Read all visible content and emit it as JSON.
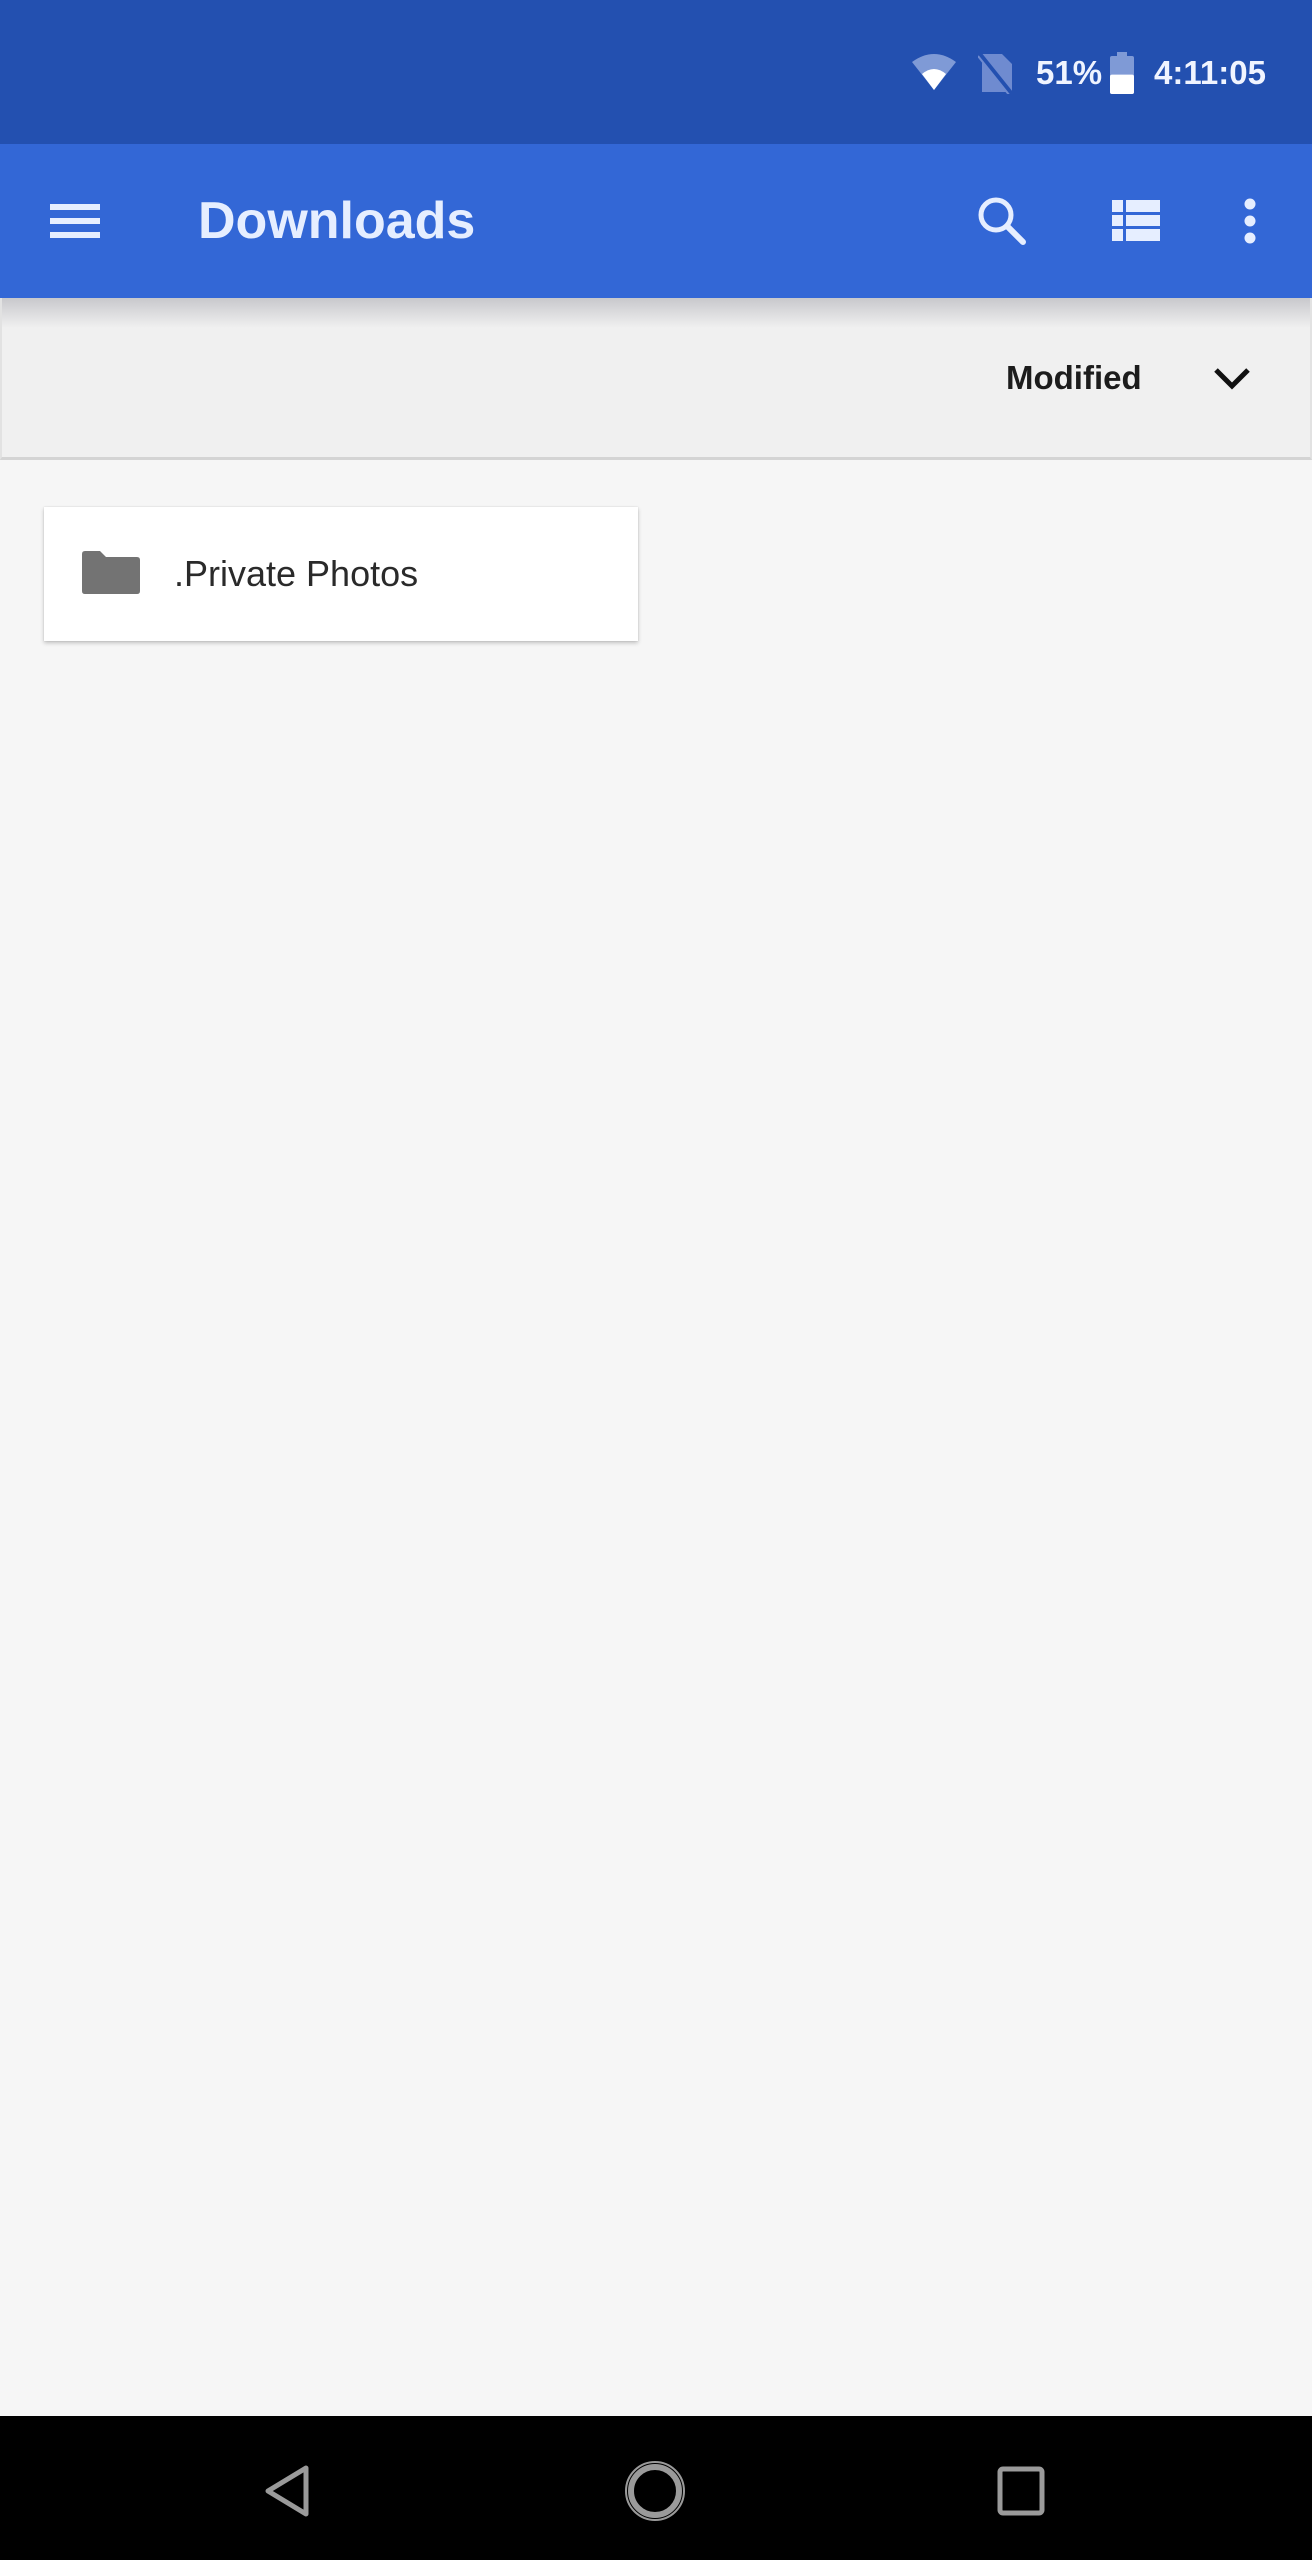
{
  "status_bar": {
    "icons": [
      "wifi-icon",
      "no-sim-icon",
      "battery-icon"
    ],
    "battery_percent": "51%",
    "battery_level": 0.51,
    "time": "4:11:05"
  },
  "app_bar": {
    "title": "Downloads",
    "nav_icon": "menu-icon",
    "actions": [
      {
        "name": "search",
        "icon": "search-icon"
      },
      {
        "name": "view-mode",
        "icon": "list-view-icon"
      },
      {
        "name": "more-options",
        "icon": "more-vert-icon"
      }
    ],
    "colors": {
      "status_bar": "#2350b0",
      "app_bar": "#3367d6",
      "text": "#e6eeff"
    }
  },
  "sort_bar": {
    "selected": "Modified",
    "icon": "chevron-down-icon"
  },
  "files": [
    {
      "name": ".Private Photos",
      "type": "folder",
      "icon": "folder-icon"
    }
  ],
  "nav_bar": {
    "buttons": [
      {
        "name": "back",
        "icon": "back-triangle-icon"
      },
      {
        "name": "home",
        "icon": "home-circle-icon"
      },
      {
        "name": "recents",
        "icon": "recents-square-icon"
      }
    ]
  }
}
